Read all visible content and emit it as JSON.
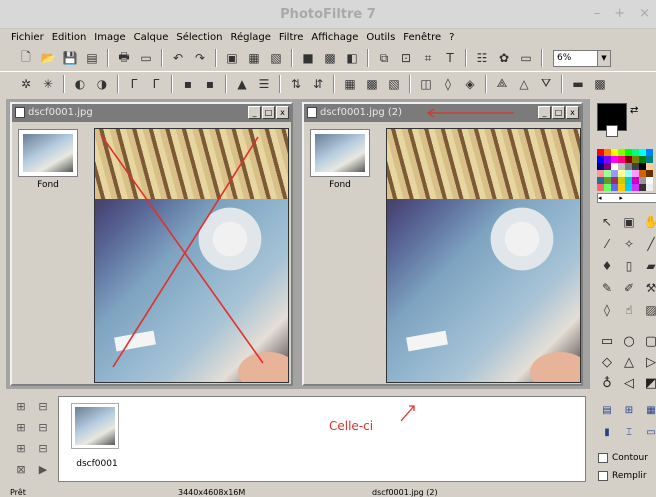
{
  "app": {
    "title": "PhotoFiltre 7",
    "window_controls": {
      "minimize": "–",
      "maximize": "+",
      "close": "×"
    }
  },
  "menu": [
    "Fichier",
    "Edition",
    "Image",
    "Calque",
    "Sélection",
    "Réglage",
    "Filtre",
    "Affichage",
    "Outils",
    "Fenêtre",
    "?"
  ],
  "toolbar": {
    "zoom_value": "6%"
  },
  "windows": [
    {
      "title": "dscf0001.jpg",
      "layer_label": "Fond",
      "buttons": [
        "_",
        "□",
        "x"
      ],
      "crossed_out": true
    },
    {
      "title": "dscf0001.jpg (2)",
      "layer_label": "Fond",
      "buttons": [
        "_",
        "□",
        "x"
      ],
      "crossed_out": false
    }
  ],
  "filmstrip": {
    "items": [
      {
        "name": "dscf0001"
      }
    ]
  },
  "annotations": {
    "note": "Celle-ci",
    "color": "#e0302c"
  },
  "options": {
    "contour": "Contour",
    "remplir": "Remplir"
  },
  "statusbar": {
    "state": "Prêt",
    "dimensions": "3440x4608x16M",
    "file": "dscf0001.jpg (2)"
  },
  "colors": {
    "foreground": "#000000",
    "background": "#ffffff",
    "annotation": "#e0302c"
  }
}
